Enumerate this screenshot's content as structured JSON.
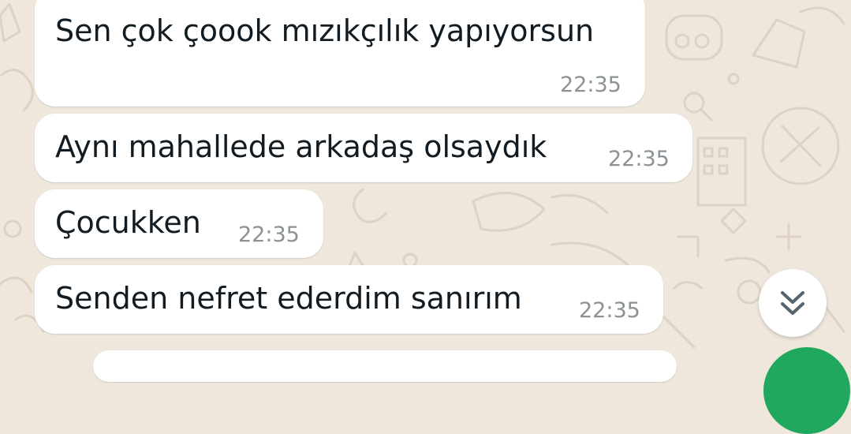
{
  "messages": [
    {
      "text": "Sen çok çoook mızıkçılık yapıyorsun",
      "time": "22:35"
    },
    {
      "text": "Aynı mahallede arkadaş olsaydık",
      "time": "22:35"
    },
    {
      "text": "Çocukken",
      "time": "22:35"
    },
    {
      "text": "Senden nefret ederdim sanırım",
      "time": "22:35"
    }
  ],
  "icons": {
    "scroll_down": "double-chevron-down-icon",
    "fab": "chat-fab"
  },
  "colors": {
    "wallpaper": "#efe7dc",
    "bubble": "#ffffff",
    "text": "#111b21",
    "timestamp": "#8a9296",
    "fab": "#21a85f"
  }
}
